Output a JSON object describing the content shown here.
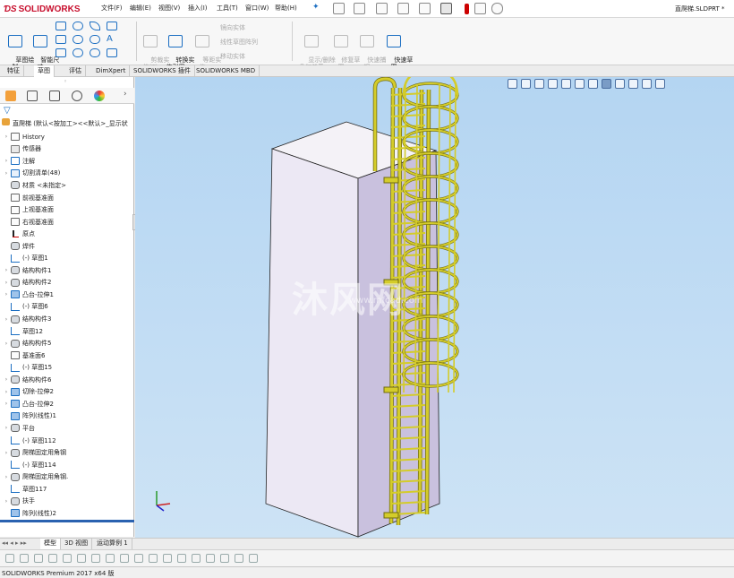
{
  "app": {
    "logo_text": "SOLIDWORKS",
    "doc_title": "直爬梯.SLDPRT *"
  },
  "menu": [
    "文件(F)",
    "编辑(E)",
    "视图(V)",
    "插入(I)",
    "工具(T)",
    "窗口(W)",
    "帮助(H)"
  ],
  "commands": {
    "sketch_draw": "草图绘\n制",
    "smart_dim": "智能尺\n寸",
    "trim_entities": "剪裁实\n体(T)",
    "convert_entities": "转换实\n体引用",
    "offset_entities": "等距实\n体",
    "mirror_entities": "镜向实体",
    "linear_pattern": "线性草图阵列",
    "move_entities": "移动实体",
    "display_relations": "显示/删除\n几何关系",
    "repair_sketch": "修复草\n图",
    "quick_snaps": "快速捕\n捉",
    "rapid_sketch": "快速草\n图"
  },
  "tabs": [
    "特征",
    "草图",
    "评估",
    "DimXpert",
    "SOLIDWORKS 插件",
    "SOLIDWORKS MBD"
  ],
  "active_tab": "草图",
  "tree": {
    "root": "直爬梯  (默认<按加工><<默认>_显示状",
    "items": [
      {
        "label": "History",
        "icon": "history",
        "exp": "›"
      },
      {
        "label": "传感器",
        "icon": "sensor",
        "exp": ""
      },
      {
        "label": "注解",
        "icon": "note",
        "exp": "›"
      },
      {
        "label": "切割清单(48)",
        "icon": "folder",
        "exp": "›"
      },
      {
        "label": "材质 <未指定>",
        "icon": "material",
        "exp": ""
      },
      {
        "label": "前视基准面",
        "icon": "plane",
        "exp": ""
      },
      {
        "label": "上视基准面",
        "icon": "plane",
        "exp": ""
      },
      {
        "label": "右视基准面",
        "icon": "plane",
        "exp": ""
      },
      {
        "label": "原点",
        "icon": "origin",
        "exp": ""
      },
      {
        "label": "焊件",
        "icon": "weld",
        "exp": ""
      },
      {
        "label": "(-) 草图1",
        "icon": "sketch",
        "exp": ""
      },
      {
        "label": "结构构件1",
        "icon": "weld",
        "exp": "›"
      },
      {
        "label": "结构构件2",
        "icon": "weld",
        "exp": "›"
      },
      {
        "label": "凸台-拉伸1",
        "icon": "feat",
        "exp": "›"
      },
      {
        "label": "(-) 草图6",
        "icon": "sketch",
        "exp": ""
      },
      {
        "label": "结构构件3",
        "icon": "weld",
        "exp": "›"
      },
      {
        "label": "草图12",
        "icon": "sketch",
        "exp": ""
      },
      {
        "label": "结构构件5",
        "icon": "weld",
        "exp": "›"
      },
      {
        "label": "基准面6",
        "icon": "plane",
        "exp": ""
      },
      {
        "label": "(-) 草图15",
        "icon": "sketch",
        "exp": ""
      },
      {
        "label": "结构构件6",
        "icon": "weld",
        "exp": "›"
      },
      {
        "label": "切除-拉伸2",
        "icon": "feat",
        "exp": "›"
      },
      {
        "label": "凸台-拉伸2",
        "icon": "feat",
        "exp": "›"
      },
      {
        "label": "阵列(线性)1",
        "icon": "pattern",
        "exp": ""
      },
      {
        "label": "平台",
        "icon": "weld",
        "exp": "›"
      },
      {
        "label": "(-) 草图112",
        "icon": "sketch",
        "exp": ""
      },
      {
        "label": "爬梯固定用角钢",
        "icon": "weld",
        "exp": "›"
      },
      {
        "label": "(-) 草图114",
        "icon": "sketch",
        "exp": ""
      },
      {
        "label": "爬梯固定用角钢.",
        "icon": "weld",
        "exp": "›"
      },
      {
        "label": "草图117",
        "icon": "sketch",
        "exp": ""
      },
      {
        "label": "扶手",
        "icon": "weld",
        "exp": "›"
      },
      {
        "label": "阵列(线性)2",
        "icon": "pattern",
        "exp": ""
      }
    ]
  },
  "watermark": {
    "text": "沐风网",
    "url": "www.mfcad.com"
  },
  "bottom_tabs": [
    "模型",
    "3D 视图",
    "运动算例 1"
  ],
  "active_bottom_tab": "模型",
  "status": "SOLIDWORKS Premium 2017 x64 版",
  "colors": {
    "brand": "#c8102e",
    "accent": "#1b6ec2",
    "ladder": "#d4cc2a",
    "viewport_top": "#b4d5f2"
  }
}
